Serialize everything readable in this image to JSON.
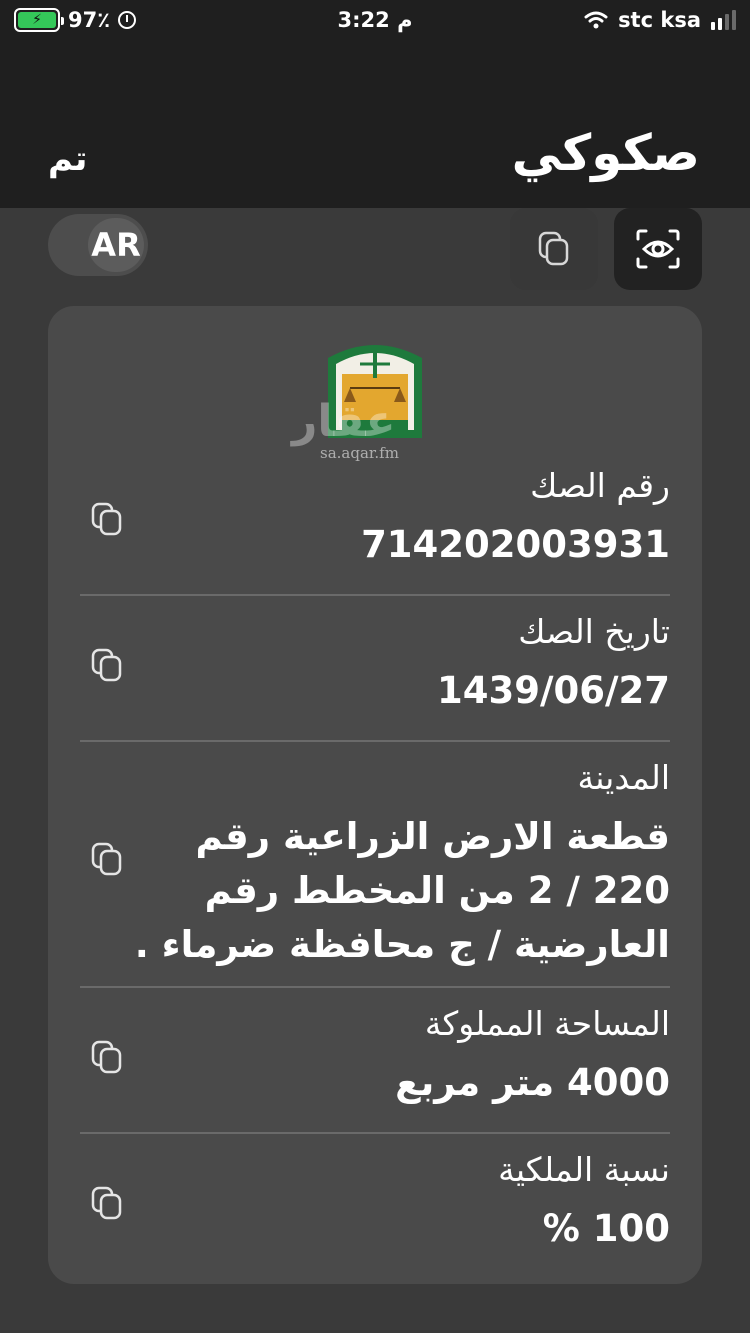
{
  "status_bar": {
    "battery_percent": "97٪",
    "time": "3:22 م",
    "carrier": "stc ksa",
    "battery_level": 0.97
  },
  "nav": {
    "title": "صكوكي",
    "done_label": "تم"
  },
  "toolbar": {
    "language_label": "AR",
    "copy_all_icon": "copy-icon",
    "view_icon": "eye-icon"
  },
  "card": {
    "watermark_text": "عقار",
    "watermark_url": "sa.aqar.fm",
    "emblem_icon": "ministry-of-justice-emblem",
    "fields": [
      {
        "label": "رقم الصك",
        "value": "714202003931"
      },
      {
        "label": "تاريخ الصك",
        "value": "1439/06/27"
      },
      {
        "label": "المدينة",
        "lines": [
          "قطعة الارض الزراعية  رقم",
          "220 / 2 من المخطط رقم",
          "العارضية / ج محافظة ضرماء ."
        ]
      },
      {
        "label": "المساحة المملوكة",
        "value": "4000 متر مربع"
      },
      {
        "label": "نسبة الملكية",
        "value": "100 %"
      }
    ]
  },
  "colors": {
    "background": "#3a3a3a",
    "header": "#1f1f1f",
    "card": "#4a4a4a",
    "battery_green": "#34c759"
  }
}
